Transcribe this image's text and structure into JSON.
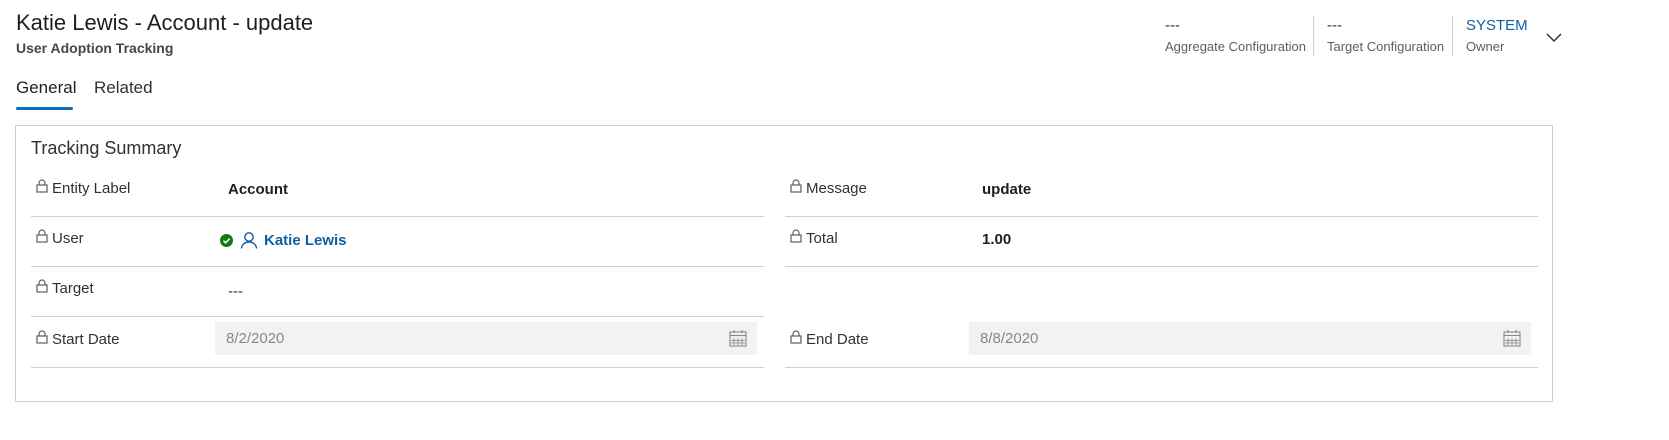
{
  "header": {
    "title": "Katie Lewis - Account - update",
    "subtitle": "User Adoption Tracking",
    "fields": [
      {
        "value": "---",
        "label": "Aggregate Configuration"
      },
      {
        "value": "---",
        "label": "Target Configuration"
      },
      {
        "value": "SYSTEM",
        "label": "Owner"
      }
    ]
  },
  "tabs": [
    {
      "label": "General",
      "active": true
    },
    {
      "label": "Related",
      "active": false
    }
  ],
  "section": {
    "title": "Tracking Summary",
    "fields": {
      "entity_label": {
        "label": "Entity Label",
        "value": "Account"
      },
      "message": {
        "label": "Message",
        "value": "update"
      },
      "user": {
        "label": "User",
        "value": "Katie Lewis"
      },
      "total": {
        "label": "Total",
        "value": "1.00"
      },
      "target": {
        "label": "Target",
        "value": "---"
      },
      "start_date": {
        "label": "Start Date",
        "value": "8/2/2020"
      },
      "end_date": {
        "label": "End Date",
        "value": "8/8/2020"
      }
    }
  },
  "colors": {
    "accent": "#0f6cbd",
    "link": "#115ea3",
    "status_available": "#107c10"
  }
}
